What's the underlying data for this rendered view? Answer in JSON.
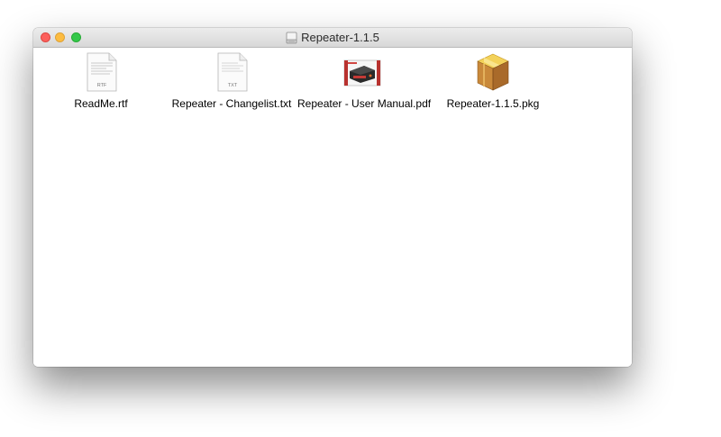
{
  "window": {
    "title": "Repeater-1.1.5",
    "title_icon": "disk-image-icon"
  },
  "colors": {
    "close": "#fc605c",
    "minimize": "#fdbc40",
    "zoom": "#34c84a"
  },
  "files": [
    {
      "name": "ReadMe.rtf",
      "icon": "rtf-document-icon",
      "badge": "RTF"
    },
    {
      "name": "Repeater - Changelist.txt",
      "icon": "txt-document-icon",
      "badge": "TXT"
    },
    {
      "name": "Repeater - User Manual.pdf",
      "icon": "pdf-document-icon"
    },
    {
      "name": "Repeater-1.1.5.pkg",
      "icon": "installer-package-icon"
    }
  ]
}
